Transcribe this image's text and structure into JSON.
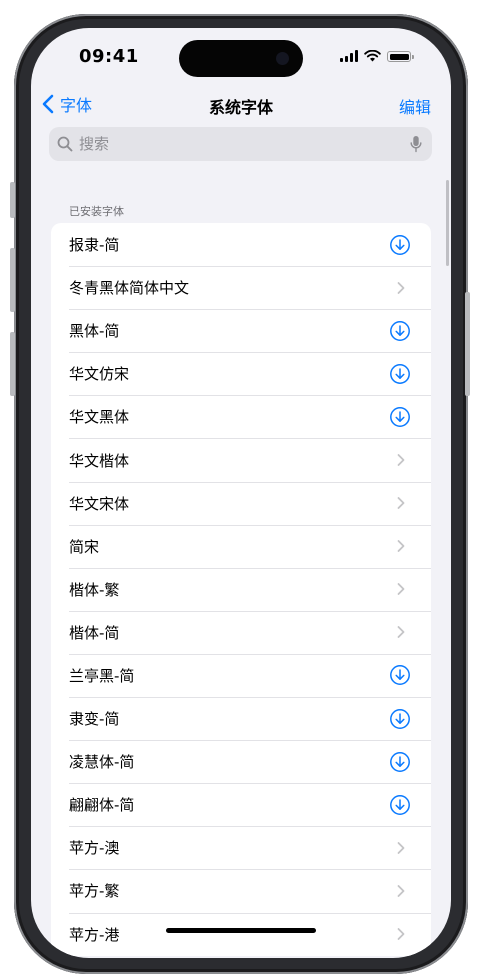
{
  "status_bar": {
    "time": "09:41"
  },
  "nav": {
    "back_label": "字体",
    "title": "系统字体",
    "edit_label": "编辑"
  },
  "search": {
    "placeholder": "搜索",
    "value": ""
  },
  "section_header": "已安装字体",
  "fonts": [
    {
      "name": "报隶-简",
      "accessory": "download"
    },
    {
      "name": "冬青黑体简体中文",
      "accessory": "chevron"
    },
    {
      "name": "黑体-简",
      "accessory": "download"
    },
    {
      "name": "华文仿宋",
      "accessory": "download"
    },
    {
      "name": "华文黑体",
      "accessory": "download"
    },
    {
      "name": "华文楷体",
      "accessory": "chevron"
    },
    {
      "name": "华文宋体",
      "accessory": "chevron"
    },
    {
      "name": "简宋",
      "accessory": "chevron"
    },
    {
      "name": "楷体-繁",
      "accessory": "chevron"
    },
    {
      "name": "楷体-简",
      "accessory": "chevron"
    },
    {
      "name": "兰亭黑-简",
      "accessory": "download"
    },
    {
      "name": "隶变-简",
      "accessory": "download"
    },
    {
      "name": "凌慧体-简",
      "accessory": "download"
    },
    {
      "name": "翩翩体-简",
      "accessory": "download"
    },
    {
      "name": "苹方-澳",
      "accessory": "chevron"
    },
    {
      "name": "苹方-繁",
      "accessory": "chevron"
    },
    {
      "name": "苹方-港",
      "accessory": "chevron"
    }
  ],
  "colors": {
    "accent": "#0a7aff",
    "background": "#f2f2f7",
    "cell": "#ffffff",
    "secondary_text": "#6e6e73",
    "chevron": "#c4c4c7"
  },
  "icons": {
    "back": "chevron-left-icon",
    "search": "magnifier-icon",
    "mic": "microphone-icon",
    "download": "download-circle-icon",
    "disclosure": "chevron-right-icon"
  }
}
